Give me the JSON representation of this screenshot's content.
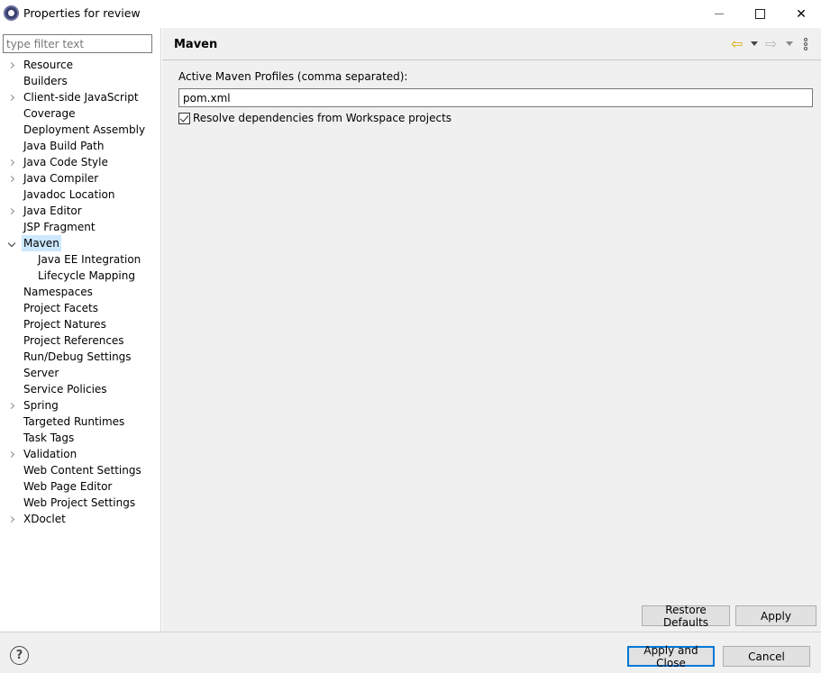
{
  "window": {
    "title": "Properties for review",
    "icon": "eclipse-icon",
    "controls": {
      "minimize": "minimize-icon",
      "maximize": "maximize-icon",
      "close": "close-icon"
    }
  },
  "filter": {
    "placeholder": "type filter text",
    "value": ""
  },
  "tree": [
    {
      "label": "Resource",
      "expandable": true,
      "expanded": false,
      "level": 0
    },
    {
      "label": "Builders",
      "expandable": false,
      "level": 0
    },
    {
      "label": "Client-side JavaScript",
      "expandable": true,
      "expanded": false,
      "level": 0
    },
    {
      "label": "Coverage",
      "expandable": false,
      "level": 0
    },
    {
      "label": "Deployment Assembly",
      "expandable": false,
      "level": 0
    },
    {
      "label": "Java Build Path",
      "expandable": false,
      "level": 0
    },
    {
      "label": "Java Code Style",
      "expandable": true,
      "expanded": false,
      "level": 0
    },
    {
      "label": "Java Compiler",
      "expandable": true,
      "expanded": false,
      "level": 0
    },
    {
      "label": "Javadoc Location",
      "expandable": false,
      "level": 0
    },
    {
      "label": "Java Editor",
      "expandable": true,
      "expanded": false,
      "level": 0
    },
    {
      "label": "JSP Fragment",
      "expandable": false,
      "level": 0
    },
    {
      "label": "Maven",
      "expandable": true,
      "expanded": true,
      "selected": true,
      "level": 0
    },
    {
      "label": "Java EE Integration",
      "expandable": false,
      "level": 1
    },
    {
      "label": "Lifecycle Mapping",
      "expandable": false,
      "level": 1
    },
    {
      "label": "Namespaces",
      "expandable": false,
      "level": 0
    },
    {
      "label": "Project Facets",
      "expandable": false,
      "level": 0
    },
    {
      "label": "Project Natures",
      "expandable": false,
      "level": 0
    },
    {
      "label": "Project References",
      "expandable": false,
      "level": 0
    },
    {
      "label": "Run/Debug Settings",
      "expandable": false,
      "level": 0
    },
    {
      "label": "Server",
      "expandable": false,
      "level": 0
    },
    {
      "label": "Service Policies",
      "expandable": false,
      "level": 0
    },
    {
      "label": "Spring",
      "expandable": true,
      "expanded": false,
      "level": 0
    },
    {
      "label": "Targeted Runtimes",
      "expandable": false,
      "level": 0
    },
    {
      "label": "Task Tags",
      "expandable": false,
      "level": 0
    },
    {
      "label": "Validation",
      "expandable": true,
      "expanded": false,
      "level": 0
    },
    {
      "label": "Web Content Settings",
      "expandable": false,
      "level": 0
    },
    {
      "label": "Web Page Editor",
      "expandable": false,
      "level": 0
    },
    {
      "label": "Web Project Settings",
      "expandable": false,
      "level": 0
    },
    {
      "label": "XDoclet",
      "expandable": true,
      "expanded": false,
      "level": 0
    }
  ],
  "page": {
    "title": "Maven",
    "profiles_label": "Active Maven Profiles (comma separated):",
    "profiles_value": "pom.xml",
    "resolve_label": "Resolve dependencies from Workspace projects",
    "resolve_checked": true,
    "restore_defaults": "Restore Defaults",
    "apply": "Apply"
  },
  "footer": {
    "help": "?",
    "apply_and_close": "Apply and Close",
    "cancel": "Cancel"
  },
  "colors": {
    "selection": "#cce8ff",
    "primary_button_border": "#0078d7",
    "back_arrow": "#e0a500"
  }
}
